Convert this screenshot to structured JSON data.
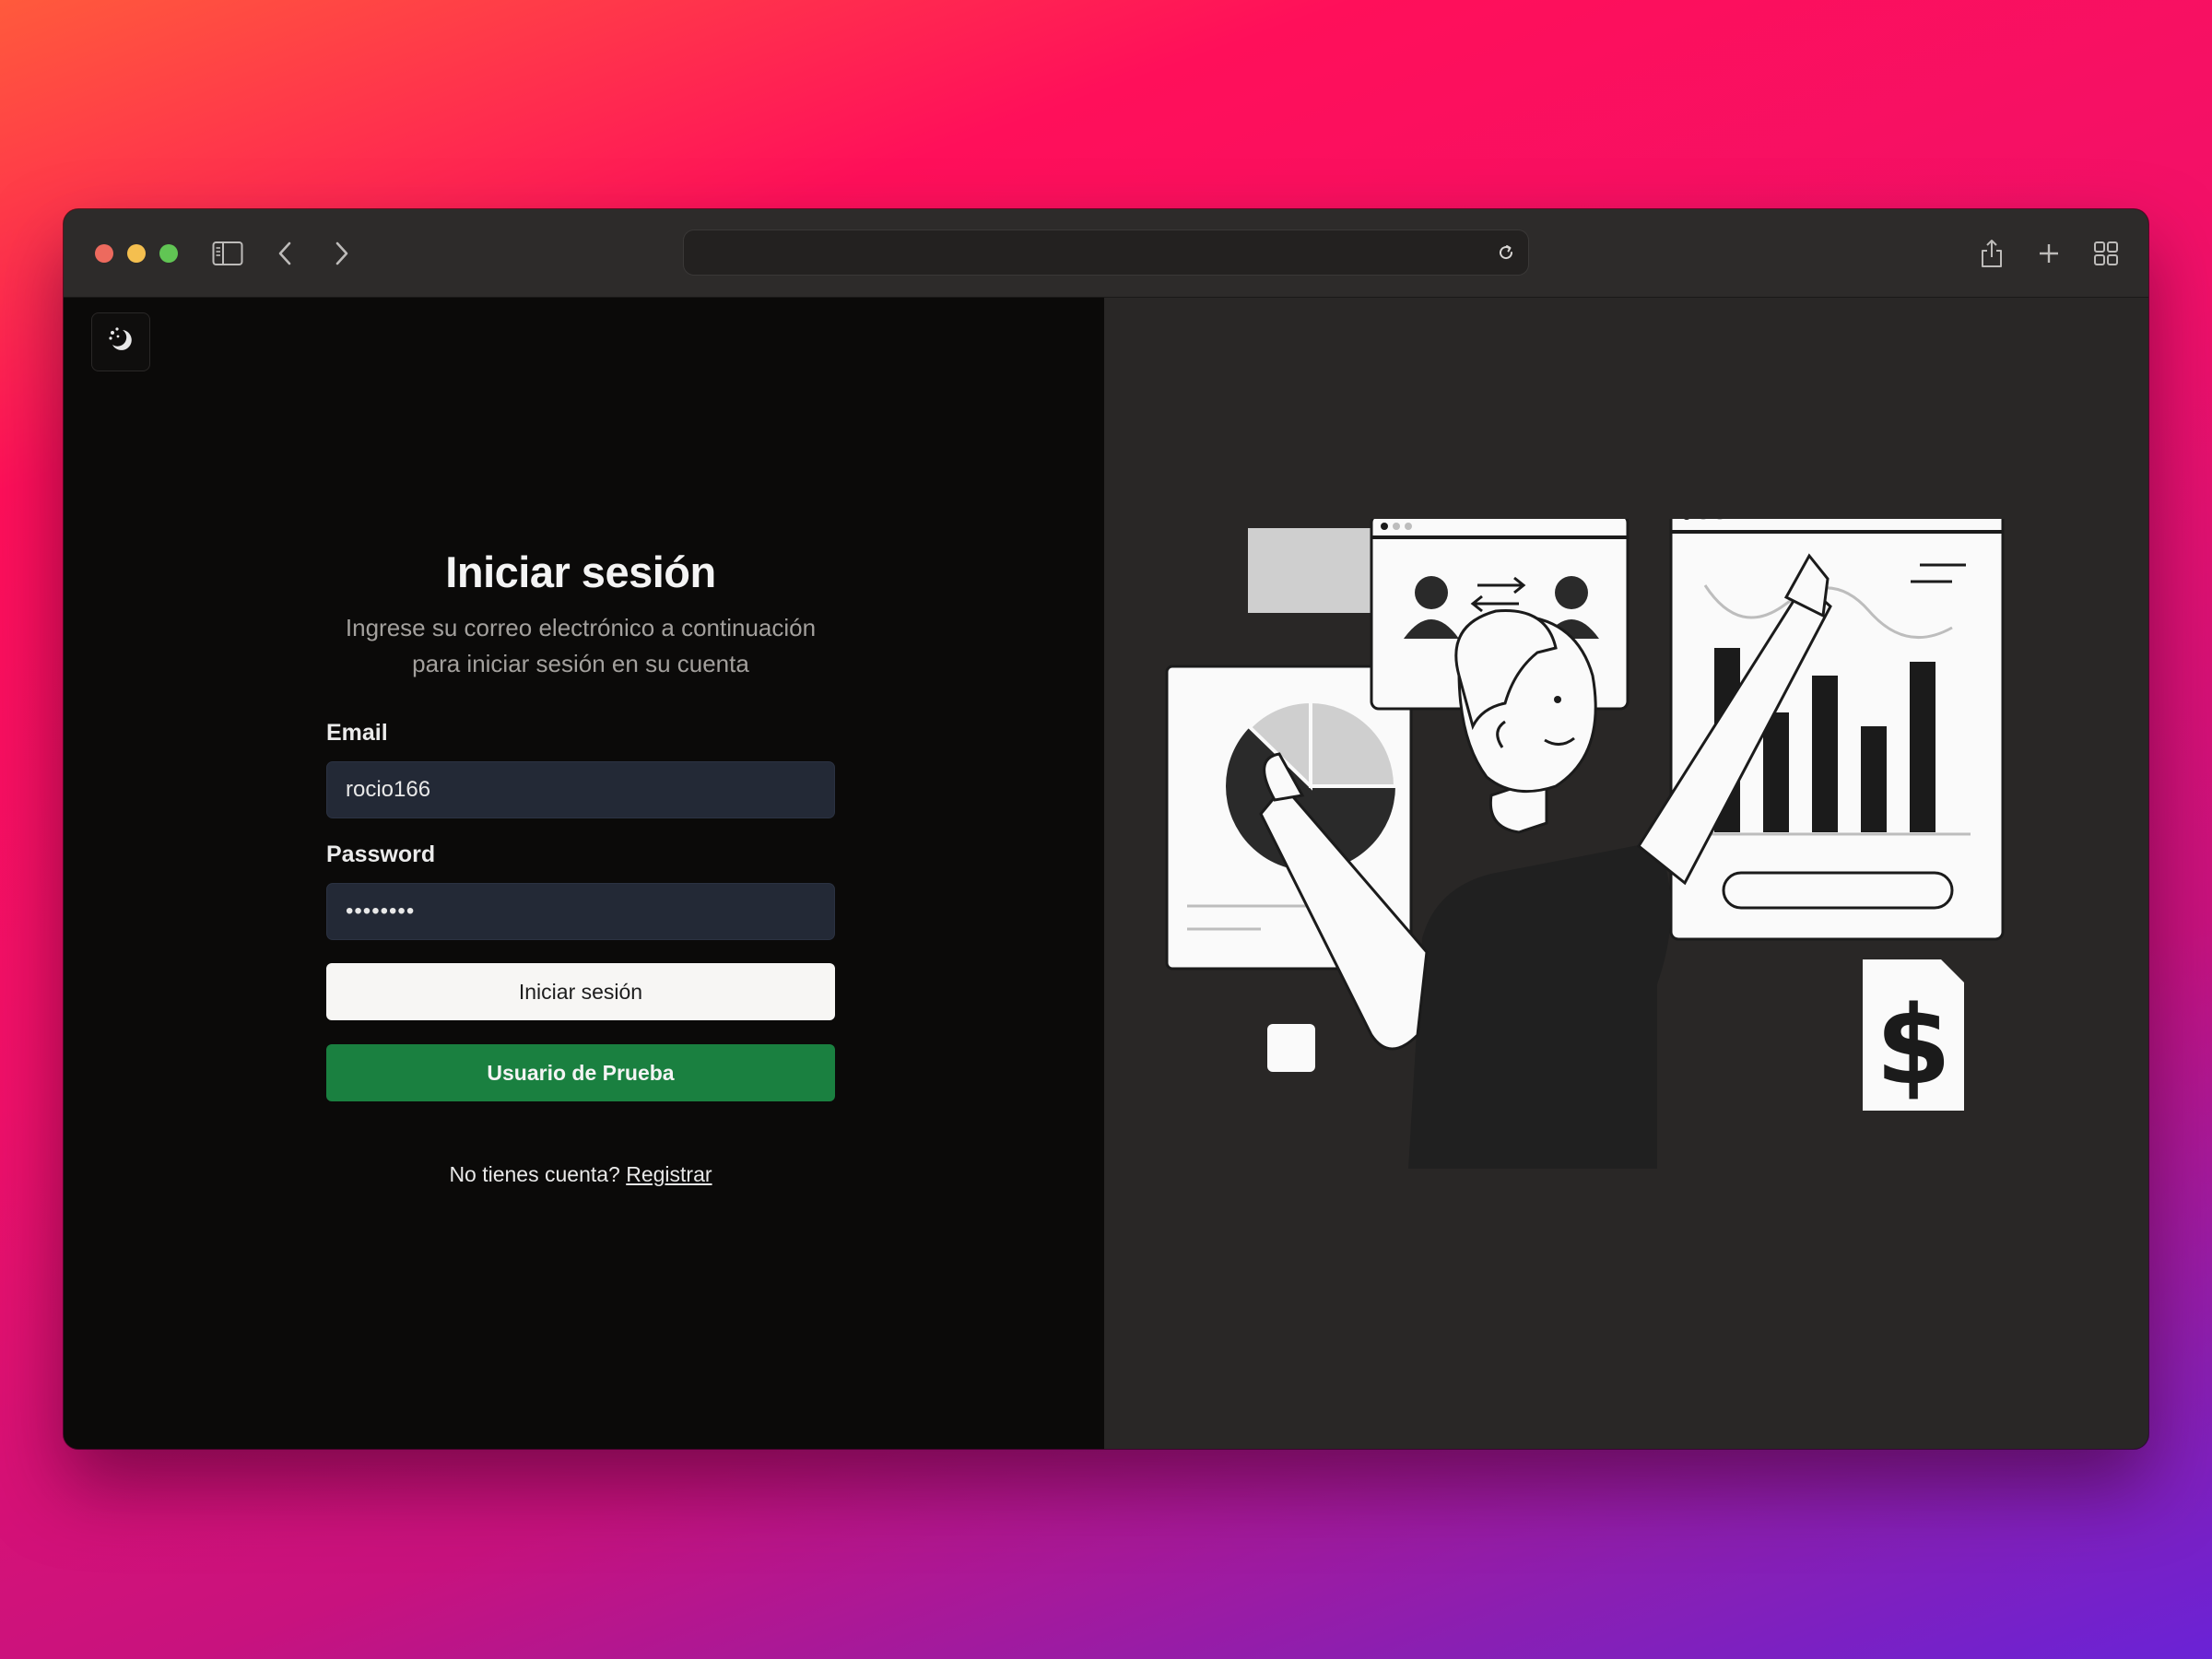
{
  "browser": {
    "url": "",
    "icons": [
      "sidebar-icon",
      "back-icon",
      "forward-icon",
      "reload-icon",
      "share-icon",
      "new-tab-icon",
      "tab-overview-icon"
    ]
  },
  "theme_toggle": {
    "icon": "theme-toggle-icon"
  },
  "login": {
    "title": "Iniciar sesión",
    "subtitle_line1": "Ingrese su correo electrónico a continuación",
    "subtitle_line2": "para iniciar sesión en su cuenta",
    "email_label": "Email",
    "email_value": "rocio166",
    "password_label": "Password",
    "password_value": "••••••••",
    "submit_label": "Iniciar sesión",
    "demo_label": "Usuario de Prueba",
    "signup_prompt": "No tienes cuenta?",
    "signup_link": "Registrar"
  },
  "colors": {
    "left_bg": "#0b0a09",
    "right_bg": "#292726",
    "input_bg": "#232936",
    "demo_button": "#1a8040",
    "primary_button": "#f7f6f4"
  }
}
